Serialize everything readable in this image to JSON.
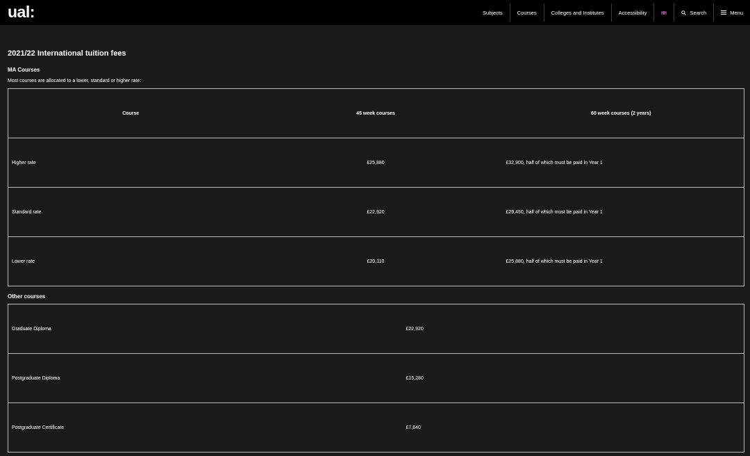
{
  "header": {
    "logo": "ual:",
    "nav": [
      {
        "label": "Subjects"
      },
      {
        "label": "Courses"
      },
      {
        "label": "Colleges and Institutes"
      },
      {
        "label": "Accessibility"
      },
      {
        "label": ""
      },
      {
        "label": "Search"
      },
      {
        "label": "Menu"
      }
    ],
    "colors": {
      "bar": "#000000",
      "page": "#1a1a1a",
      "text": "#ffffff",
      "border": "#bdbdbd"
    }
  },
  "page": {
    "title": "2021/22 International tuition fees",
    "ma_heading": "MA Courses",
    "intro": "Most courses are allocated to a lower, standard or higher rate:",
    "other_heading": "Other courses"
  },
  "ma_table": {
    "headers": [
      "Course",
      "45 week courses",
      "60 week courses (2 years)"
    ],
    "rows": [
      [
        "Higher rate",
        "£25,880",
        "£32,900, half of which must be paid in Year 1"
      ],
      [
        "Standard rate",
        "£22,920",
        "£29,450, half of which must be paid in Year 1"
      ],
      [
        "Lower rate",
        "£20,110",
        "£25,880, half of which must be paid in Year 1"
      ]
    ]
  },
  "other_table": {
    "rows": [
      [
        "Graduate Diploma",
        "£22,920"
      ],
      [
        "Postgraduate Diploma",
        "£15,280"
      ],
      [
        "Postgraduate Certificate",
        "£7,640"
      ]
    ]
  }
}
